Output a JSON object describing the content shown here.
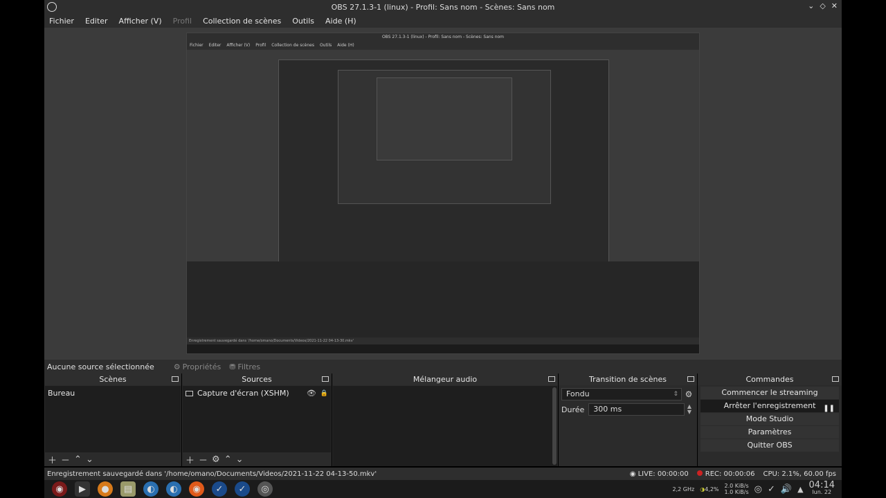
{
  "window": {
    "title": "OBS 27.1.3-1 (linux) - Profil: Sans nom - Scènes: Sans nom",
    "controls": [
      "⌄",
      "◇",
      "✕"
    ]
  },
  "menu": {
    "items": [
      "Fichier",
      "Editer",
      "Afficher (V)",
      "Profil",
      "Collection de scènes",
      "Outils",
      "Aide (H)"
    ]
  },
  "nested_preview": {
    "title": "OBS 27.1.3-1 (linux) - Profil: Sans nom - Scènes: Sans nom",
    "menu": [
      "Fichier",
      "Editer",
      "Afficher (V)",
      "Profil",
      "Collection de scènes",
      "Outils",
      "Aide (H)"
    ],
    "status": "Enregistrement sauvegardé dans '/home/omano/Documents/Videos/2021-11-22 04-13-30.mkv'"
  },
  "sourcebar": {
    "no_selection": "Aucune source sélectionnée",
    "properties": "Propriétés",
    "filters": "Filtres"
  },
  "docks": {
    "scenes": {
      "title": "Scènes",
      "items": [
        "Bureau"
      ]
    },
    "sources": {
      "title": "Sources",
      "items": [
        "Capture d'écran (XSHM)"
      ]
    },
    "mixer": {
      "title": "Mélangeur audio"
    },
    "transitions": {
      "title": "Transition de scènes",
      "type": "Fondu",
      "duration_label": "Durée",
      "duration": "300 ms"
    },
    "commands": {
      "title": "Commandes",
      "buttons": [
        "Commencer le streaming",
        "Arrêter l'enregistrement",
        "Mode Studio",
        "Paramètres",
        "Quitter OBS"
      ]
    }
  },
  "status": {
    "message": "Enregistrement sauvegardé dans '/home/omano/Documents/Videos/2021-11-22 04-13-50.mkv'",
    "live": "LIVE: 00:00:00",
    "rec": "REC: 00:00:06",
    "cpu": "CPU: 2.1%, 60.00 fps"
  },
  "taskbar": {
    "cpu_freq": "2,2 GHz",
    "battery": "4,2%",
    "net_down": "2.0 KiB/s",
    "net_up": "1.0 KiB/s",
    "time": "04:14",
    "date": "lun. 22"
  }
}
